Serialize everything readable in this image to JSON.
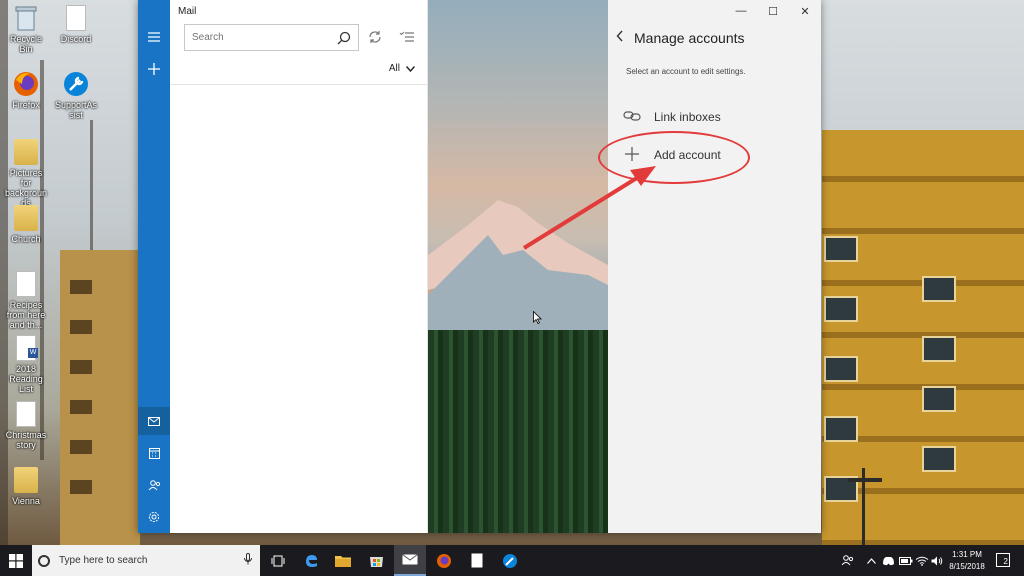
{
  "desktop": {
    "icons": [
      {
        "label": "Recycle Bin",
        "icon": "recycle-bin-icon"
      },
      {
        "label": "Discord",
        "icon": "file-icon"
      },
      {
        "label": "Firefox",
        "icon": "firefox-icon"
      },
      {
        "label": "SupportAssist",
        "icon": "support-assist-icon"
      },
      {
        "label": "Pictures for backgrounds",
        "icon": "folder-icon"
      },
      {
        "label": "Church",
        "icon": "folder-icon"
      },
      {
        "label": "Recipes from here and th...",
        "icon": "document-icon"
      },
      {
        "label": "2018 Reading List",
        "icon": "word-document-icon"
      },
      {
        "label": "Christmas story",
        "icon": "document-icon"
      },
      {
        "label": "Vienna",
        "icon": "folder-icon"
      }
    ]
  },
  "mail": {
    "app_title": "Mail",
    "search_placeholder": "Search",
    "filter_label": "All",
    "window_controls": {
      "minimize": "—",
      "maximize": "☐",
      "close": "✕"
    },
    "manage_accounts": {
      "title": "Manage accounts",
      "hint": "Select an account to edit settings.",
      "items": [
        {
          "label": "Link inboxes",
          "icon": "link-icon"
        },
        {
          "label": "Add account",
          "icon": "plus-icon"
        }
      ]
    }
  },
  "taskbar": {
    "search_placeholder": "Type here to search",
    "clock_time": "1:31 PM",
    "clock_date": "8/15/2018",
    "notification_count": "2"
  },
  "colors": {
    "nav_rail": "#1a74c6",
    "annotation": "#e23b3b",
    "taskbar": "#1b1b1f"
  }
}
